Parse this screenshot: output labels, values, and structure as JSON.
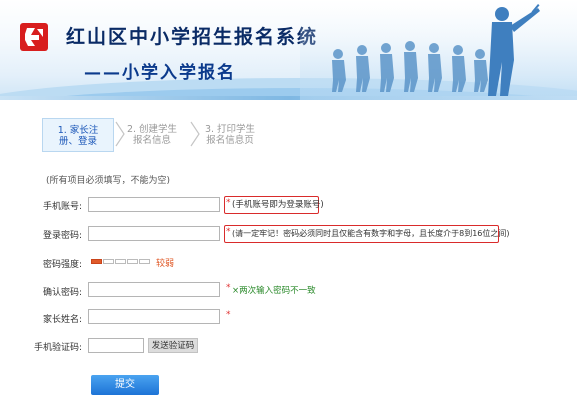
{
  "header": {
    "title": "红山区中小学招生报名系统",
    "subtitle": "——小学入学报名",
    "logo_icon": "red-square-logo-icon",
    "hero_icon": "running-children-silhouette"
  },
  "steps": [
    {
      "label_line1": "1. 家长注",
      "label_line2": "册、登录",
      "active": true
    },
    {
      "label_line1": "2. 创建学生",
      "label_line2": "报名信息",
      "active": false
    },
    {
      "label_line1": "3. 打印学生",
      "label_line2": "报名信息页",
      "active": false
    }
  ],
  "form": {
    "required_hint": "(所有项目必须填写，不能为空)",
    "phone": {
      "label": "手机账号:",
      "value": "",
      "star": "*",
      "tip": "(手机账号即为登录账号)"
    },
    "password": {
      "label": "登录密码:",
      "value": "",
      "star": "*",
      "tip": "(请一定牢记！密码必须同时且仅能含有数字和字母，且长度介于8到16位之间)"
    },
    "strength": {
      "label": "密码强度:",
      "level": 1,
      "total": 5,
      "text": "较弱"
    },
    "confirm": {
      "label": "确认密码:",
      "value": "",
      "star": "*",
      "error": "×两次输入密码不一致"
    },
    "parent_name": {
      "label": "家长姓名:",
      "value": "",
      "star": "*"
    },
    "sms_code": {
      "label": "手机验证码:",
      "value": "",
      "send_button": "发送验证码"
    },
    "submit_button": "提交"
  },
  "colors": {
    "accent": "#1d73d6",
    "error_border": "#d92b2b",
    "title": "#0a2b66",
    "strength": "#e05b2a"
  }
}
